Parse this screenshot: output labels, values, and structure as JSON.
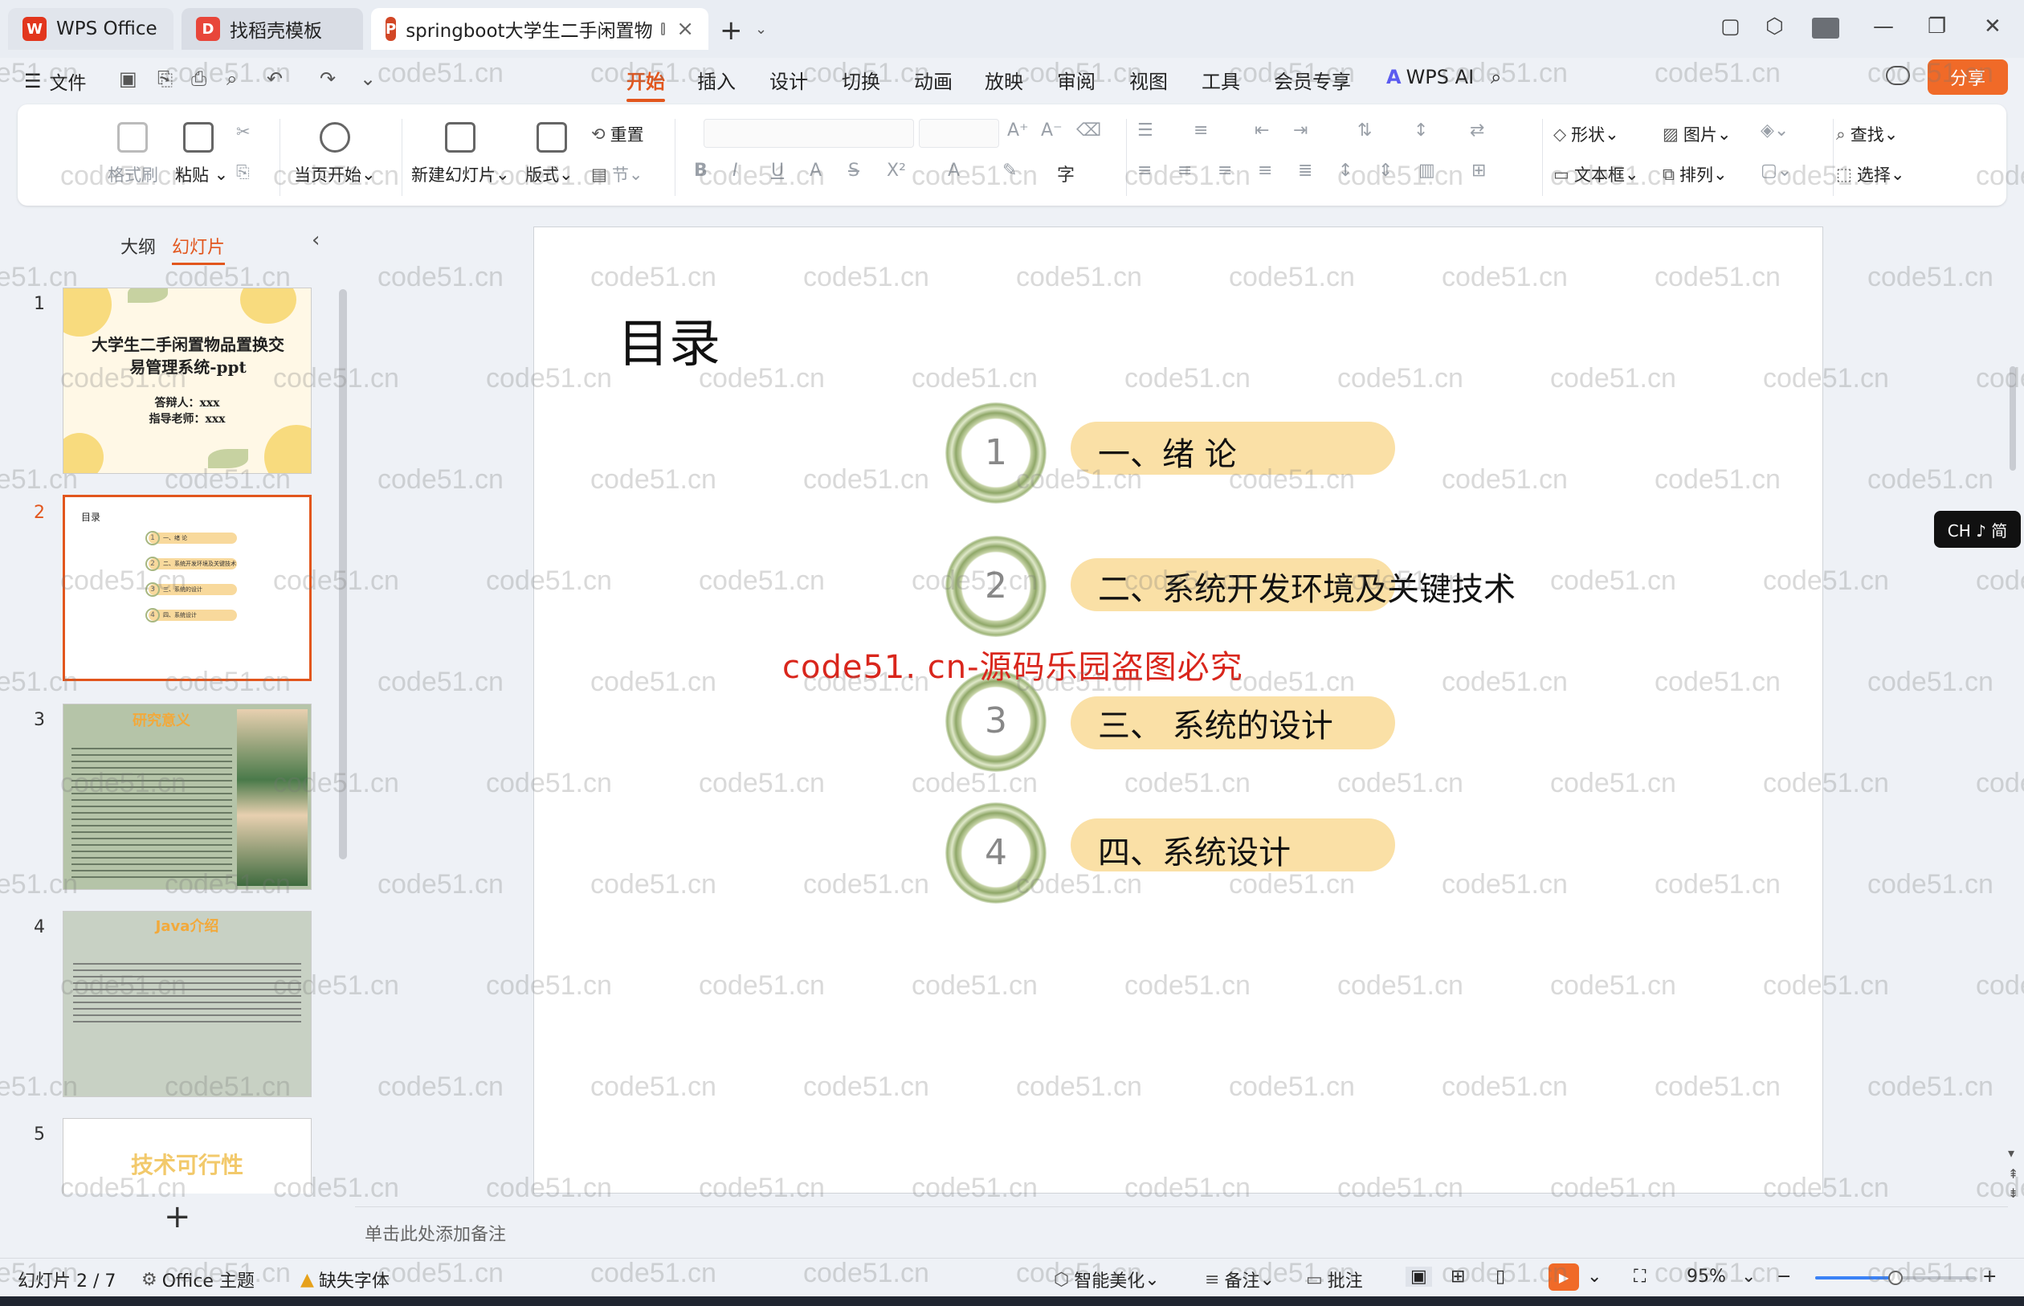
{
  "window": {
    "tabs": [
      {
        "label": "WPS Office",
        "logo": "W",
        "logo_color": "#e2361d"
      },
      {
        "label": "找稻壳模板",
        "logo": "D",
        "logo_color": "#e8463a"
      },
      {
        "label": "springboot大学生二手闲置物",
        "logo": "P",
        "logo_color": "#d24726"
      }
    ],
    "new_tab_icon": "+"
  },
  "menu": {
    "file_label": "文件",
    "items": [
      "开始",
      "插入",
      "设计",
      "切换",
      "动画",
      "放映",
      "审阅",
      "视图",
      "工具",
      "会员专享"
    ],
    "active_item": "开始",
    "wps_ai_label": "WPS AI",
    "share_label": "分享"
  },
  "ribbon": {
    "format_painter": "格式刷",
    "paste": "粘贴",
    "start_current": "当页开始",
    "new_slide": "新建幻灯片",
    "layout": "版式",
    "reset": "重置",
    "section": "节",
    "shape": "形状",
    "picture": "图片",
    "textbox": "文本框",
    "arrange": "排列",
    "find": "查找",
    "select": "选择"
  },
  "left_panel": {
    "tab_outline": "大纲",
    "tab_slides": "幻灯片",
    "active_tab": "幻灯片",
    "thumbs": [
      {
        "num": "1",
        "title": "大学生二手闲置物品置换交易管理系统-ppt",
        "line1": "答辩人：xxx",
        "line2": "指导老师：xxx"
      },
      {
        "num": "2",
        "title": "目录",
        "items": [
          "一、绪 论",
          "二、系统开发环境及关键技术",
          "三、系统的设计",
          "四、系统设计"
        ]
      },
      {
        "num": "3",
        "title": "研究意义"
      },
      {
        "num": "4",
        "title": "Java介绍"
      },
      {
        "num": "5",
        "title": "技术可行性"
      }
    ],
    "add_label": "+"
  },
  "slide": {
    "title": "目录",
    "items": [
      {
        "num": "1",
        "label": "一、绪  论"
      },
      {
        "num": "2",
        "label": "二、系统开发环境及关键技术"
      },
      {
        "num": "3",
        "label": "三、 系统的设计"
      },
      {
        "num": "4",
        "label": "四、系统设计"
      }
    ],
    "overlay_text": "code51. cn-源码乐园盗图必究"
  },
  "ime": {
    "label": "CH ♪ 简"
  },
  "notes": {
    "placeholder": "单击此处添加备注"
  },
  "status": {
    "slide_counter": "幻灯片 2 / 7",
    "theme": "Office 主题",
    "missing_font": "缺失字体",
    "beautify": "智能美化",
    "notes": "备注",
    "comment": "批注",
    "zoom": "95%",
    "zoom_fraction": 0.5
  },
  "watermark_text": "code51.cn",
  "colors": {
    "accent": "#e2561d",
    "pill": "#fae0a6",
    "share": "#f06a28",
    "overlay_red": "#d9261c"
  }
}
